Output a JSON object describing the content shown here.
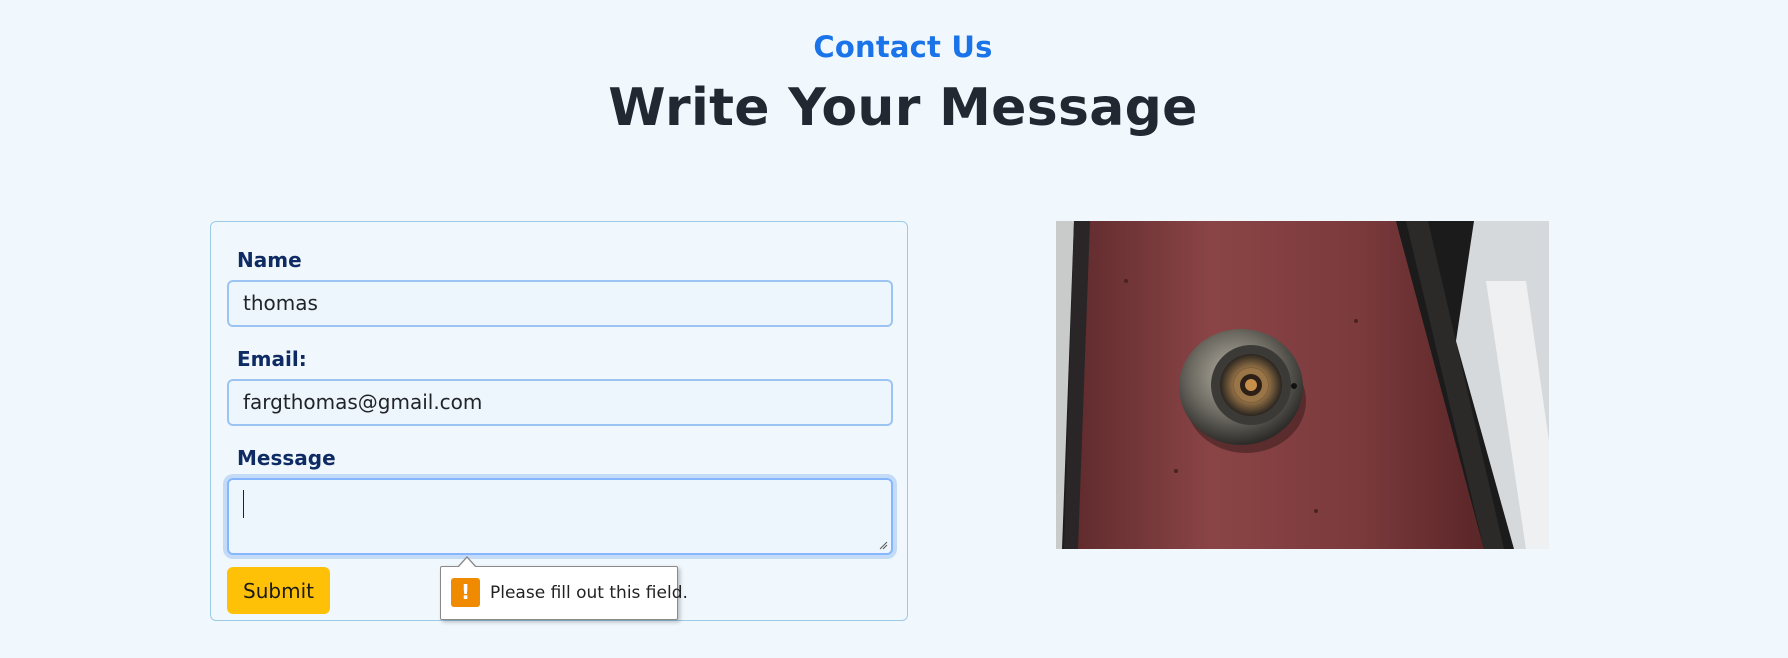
{
  "section": {
    "eyebrow": "Contact Us",
    "title": "Write Your Message"
  },
  "form": {
    "name_label": "Name",
    "name_value": "thomas",
    "email_label": "Email:",
    "email_value": "fargthomas@gmail.com",
    "message_label": "Message",
    "message_value": "",
    "submit_label": "Submit"
  },
  "validation": {
    "message": "Please fill out this field.",
    "icon": "warning-icon"
  },
  "image": {
    "subject": "security camera on red wall"
  },
  "colors": {
    "accent": "#1a73e8",
    "heading": "#222831",
    "label": "#0f2b63",
    "button": "#ffc107",
    "warning": "#f08a00",
    "background": "#f0f8fd"
  }
}
